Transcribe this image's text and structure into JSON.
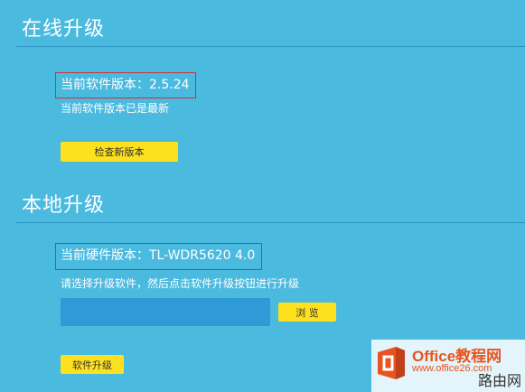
{
  "online": {
    "title": "在线升级",
    "current_version": "当前软件版本：2.5.24",
    "status": "当前软件版本已是最新",
    "check_button": "检查新版本"
  },
  "local": {
    "title": "本地升级",
    "hardware_version": "当前硬件版本：TL-WDR5620 4.0",
    "instruction": "请选择升级软件，然后点击软件升级按钮进行升级",
    "file_value": "",
    "browse_button": "浏 览",
    "upgrade_button": "软件升级"
  },
  "watermark": {
    "title": "Office教程网",
    "url": "www.office26.com",
    "sub": "路由网"
  },
  "colors": {
    "background": "#4bbadf",
    "button": "#fde11f",
    "highlight_border": "#d0303a",
    "file_input": "#2e9bd6"
  }
}
